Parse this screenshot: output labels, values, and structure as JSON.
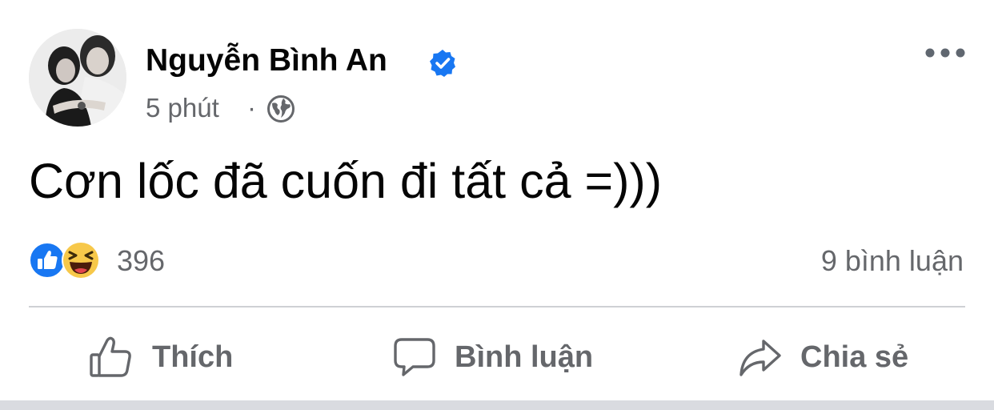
{
  "post": {
    "author_name": "Nguyễn Bình An",
    "verified_icon": "verified-badge-icon",
    "time": "5 phút",
    "meta_separator": "·",
    "audience_icon": "globe-icon",
    "more_icon": "more-options-icon",
    "text": "Cơn lốc đã cuốn đi tất cả =)))",
    "reactions": {
      "icons": [
        "like-reaction-icon",
        "haha-reaction-icon"
      ],
      "count": "396"
    },
    "comments_count": "9 bình luận"
  },
  "actions": {
    "like_label": "Thích",
    "comment_label": "Bình luận",
    "share_label": "Chia sẻ"
  },
  "colors": {
    "text_primary": "#050505",
    "text_secondary": "#65676b",
    "brand_blue": "#1877f2",
    "divider": "#ced0d4"
  }
}
